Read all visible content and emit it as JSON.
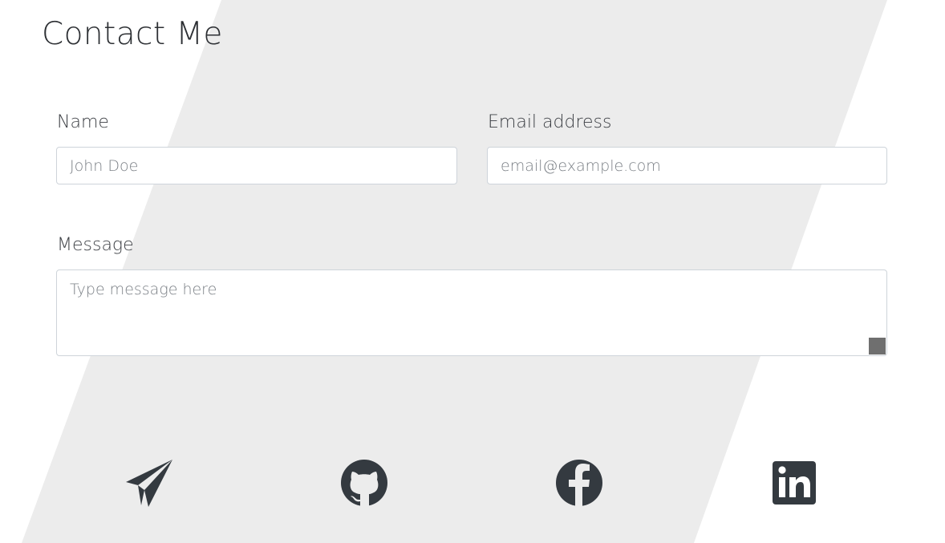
{
  "page": {
    "title": "Contact Me",
    "background_shape_color": "#ececec",
    "icon_color": "#343a40"
  },
  "form": {
    "name": {
      "label": "Name",
      "value": "",
      "placeholder": "John Doe"
    },
    "email": {
      "label": "Email address",
      "value": "",
      "placeholder": "email@example.com"
    },
    "message": {
      "label": "Message",
      "value": "",
      "placeholder": "Type message here"
    }
  },
  "social_links": [
    {
      "icon": "send-icon",
      "name": "Send"
    },
    {
      "icon": "github-icon",
      "name": "GitHub"
    },
    {
      "icon": "facebook-icon",
      "name": "Facebook"
    },
    {
      "icon": "linkedin-icon",
      "name": "LinkedIn"
    }
  ]
}
